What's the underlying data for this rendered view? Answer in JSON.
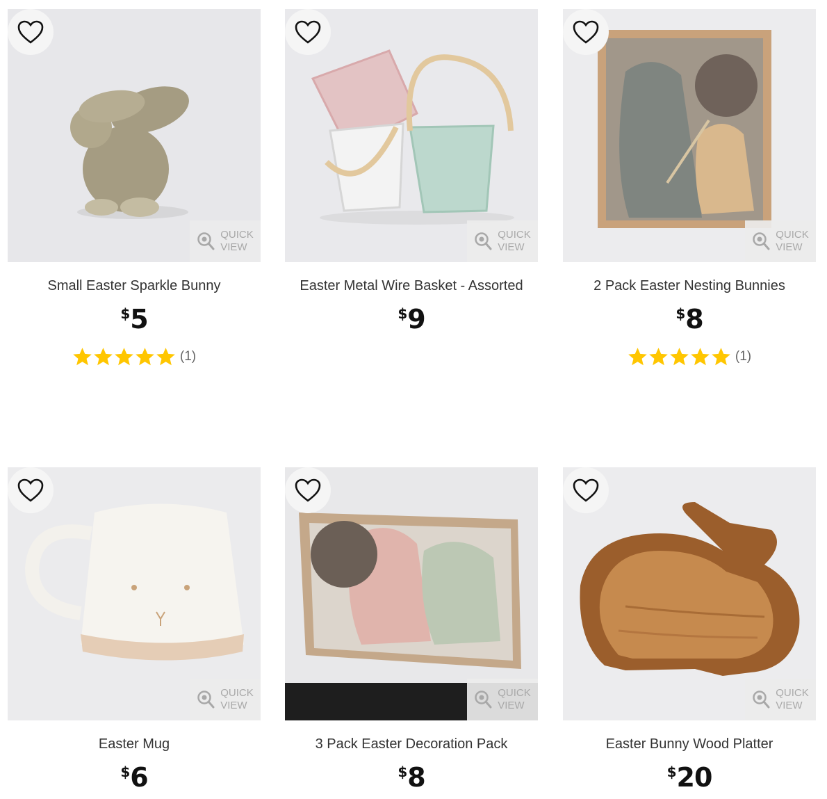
{
  "quick_view": {
    "line1": "QUICK",
    "line2": "VIEW"
  },
  "colors": {
    "star": "#ffc600",
    "price": "#111111",
    "quick_view_text": "#a8a8a8"
  },
  "products": [
    {
      "title": "Small Easter Sparkle Bunny",
      "currency": "$",
      "price": "5",
      "rating": 5,
      "review_count": "(1)",
      "image": "sparkle-bunny-figurine"
    },
    {
      "title": "Easter Metal Wire Basket - Assorted",
      "currency": "$",
      "price": "9",
      "rating": null,
      "review_count": "",
      "image": "wire-baskets"
    },
    {
      "title": "2 Pack Easter Nesting Bunnies",
      "currency": "$",
      "price": "8",
      "rating": 5,
      "review_count": "(1)",
      "image": "nesting-bunnies-box"
    },
    {
      "title": "Easter Mug",
      "currency": "$",
      "price": "6",
      "rating": null,
      "review_count": "",
      "image": "bunny-mug"
    },
    {
      "title": "3 Pack Easter Decoration Pack",
      "currency": "$",
      "price": "8",
      "rating": null,
      "review_count": "",
      "image": "decoration-pack-box"
    },
    {
      "title": "Easter Bunny Wood Platter",
      "currency": "$",
      "price": "20",
      "rating": null,
      "review_count": "",
      "image": "bunny-wood-platter"
    }
  ]
}
